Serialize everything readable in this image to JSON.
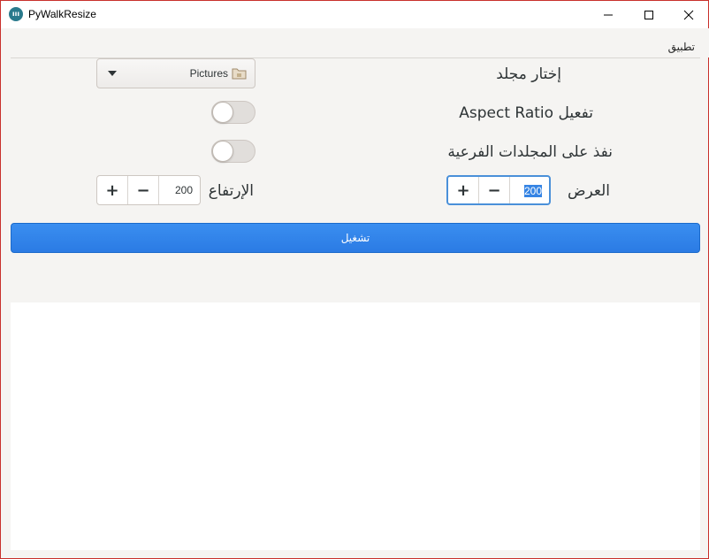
{
  "window": {
    "title": "PyWalkResize",
    "icon": "app-logo-icon",
    "border_color": "#c9302c"
  },
  "menubar": {
    "items": [
      {
        "label": "تطبيق"
      }
    ]
  },
  "form": {
    "folder": {
      "label": "إختار مجلد",
      "selected": "Pictures",
      "icon": "folder-icon"
    },
    "aspect_ratio": {
      "label": "تفعيل Aspect Ratio",
      "enabled": false
    },
    "subfolders": {
      "label": "نفذ على المجلدات الفرعية",
      "enabled": false
    },
    "width": {
      "label": "العرض",
      "value": "200"
    },
    "height": {
      "label": "الإرتفاع",
      "value": "200"
    },
    "increment_symbol": "+",
    "decrement_symbol": "−"
  },
  "run_button": {
    "label": "تشغيل",
    "color": "#2b7be4"
  }
}
